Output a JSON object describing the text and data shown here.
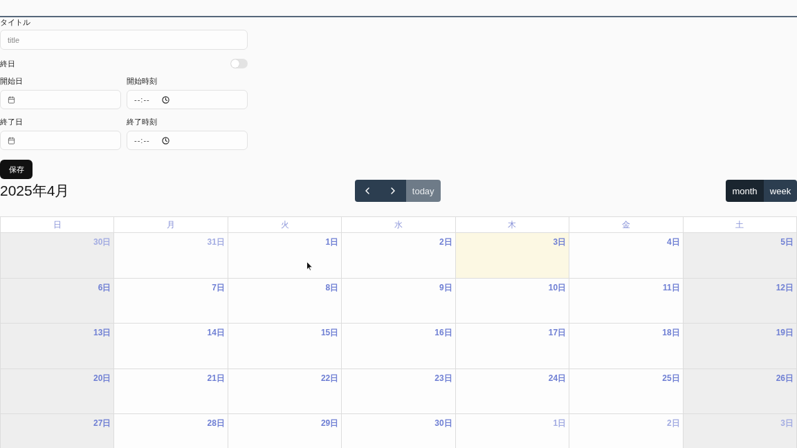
{
  "form": {
    "title": {
      "label": "タイトル",
      "placeholder": "title"
    },
    "all_day": {
      "label": "終日",
      "on": false
    },
    "rows": [
      {
        "date": {
          "label": "開始日"
        },
        "time": {
          "label": "開始時刻",
          "placeholder": "--:--"
        }
      },
      {
        "date": {
          "label": "終了日"
        },
        "time": {
          "label": "終了時刻",
          "placeholder": "--:--"
        }
      }
    ],
    "save_button": "保存"
  },
  "calendar": {
    "title": "2025年4月",
    "nav": [
      {
        "kind": "prev",
        "disabled": false
      },
      {
        "kind": "next",
        "disabled": false
      },
      {
        "kind": "today",
        "label": "today",
        "disabled": true
      }
    ],
    "views": [
      {
        "label": "month",
        "selected": true
      },
      {
        "label": "week",
        "selected": false
      }
    ],
    "weekdays": [
      {
        "label": "日",
        "weekend": true
      },
      {
        "label": "月",
        "weekend": false
      },
      {
        "label": "火",
        "weekend": false
      },
      {
        "label": "水",
        "weekend": false
      },
      {
        "label": "木",
        "weekend": false
      },
      {
        "label": "金",
        "weekend": false
      },
      {
        "label": "土",
        "weekend": true
      }
    ],
    "weeks": [
      [
        {
          "label": "30日",
          "other_month": true,
          "today": false
        },
        {
          "label": "31日",
          "other_month": true,
          "today": false
        },
        {
          "label": "1日",
          "other_month": false,
          "today": false
        },
        {
          "label": "2日",
          "other_month": false,
          "today": false
        },
        {
          "label": "3日",
          "other_month": false,
          "today": true
        },
        {
          "label": "4日",
          "other_month": false,
          "today": false
        },
        {
          "label": "5日",
          "other_month": false,
          "today": false
        }
      ],
      [
        {
          "label": "6日",
          "other_month": false,
          "today": false
        },
        {
          "label": "7日",
          "other_month": false,
          "today": false
        },
        {
          "label": "8日",
          "other_month": false,
          "today": false
        },
        {
          "label": "9日",
          "other_month": false,
          "today": false
        },
        {
          "label": "10日",
          "other_month": false,
          "today": false
        },
        {
          "label": "11日",
          "other_month": false,
          "today": false
        },
        {
          "label": "12日",
          "other_month": false,
          "today": false
        }
      ],
      [
        {
          "label": "13日",
          "other_month": false,
          "today": false
        },
        {
          "label": "14日",
          "other_month": false,
          "today": false
        },
        {
          "label": "15日",
          "other_month": false,
          "today": false
        },
        {
          "label": "16日",
          "other_month": false,
          "today": false
        },
        {
          "label": "17日",
          "other_month": false,
          "today": false
        },
        {
          "label": "18日",
          "other_month": false,
          "today": false
        },
        {
          "label": "19日",
          "other_month": false,
          "today": false
        }
      ],
      [
        {
          "label": "20日",
          "other_month": false,
          "today": false
        },
        {
          "label": "21日",
          "other_month": false,
          "today": false
        },
        {
          "label": "22日",
          "other_month": false,
          "today": false
        },
        {
          "label": "23日",
          "other_month": false,
          "today": false
        },
        {
          "label": "24日",
          "other_month": false,
          "today": false
        },
        {
          "label": "25日",
          "other_month": false,
          "today": false
        },
        {
          "label": "26日",
          "other_month": false,
          "today": false
        }
      ],
      [
        {
          "label": "27日",
          "other_month": false,
          "today": false
        },
        {
          "label": "28日",
          "other_month": false,
          "today": false
        },
        {
          "label": "29日",
          "other_month": false,
          "today": false
        },
        {
          "label": "30日",
          "other_month": false,
          "today": false
        },
        {
          "label": "1日",
          "other_month": true,
          "today": false
        },
        {
          "label": "2日",
          "other_month": true,
          "today": false
        },
        {
          "label": "3日",
          "other_month": true,
          "today": false
        }
      ]
    ]
  }
}
